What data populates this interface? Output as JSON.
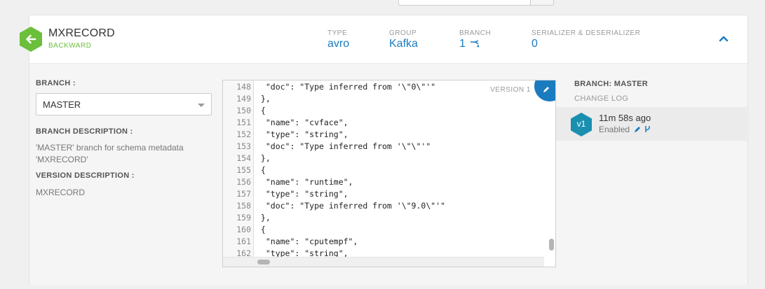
{
  "schema": {
    "name": "MXRECORD",
    "compatibility": "BACKWARD"
  },
  "meta": {
    "type_label": "TYPE",
    "type_value": "avro",
    "group_label": "GROUP",
    "group_value": "Kafka",
    "branch_label": "BRANCH",
    "branch_value": "1",
    "serde_label": "SERIALIZER & DESERIALIZER",
    "serde_value": "0"
  },
  "left": {
    "branch_label": "BRANCH :",
    "branch_selected": "MASTER",
    "branch_desc_label": "BRANCH DESCRIPTION :",
    "branch_desc": "'MASTER' branch for schema metadata 'MXRECORD'",
    "version_desc_label": "VERSION DESCRIPTION :",
    "version_desc": "MXRECORD"
  },
  "editor": {
    "version_label": "VERSION 1",
    "lines": [
      {
        "n": "148",
        "t": "  \"doc\": \"Type inferred from '\\\"0\\\"'\""
      },
      {
        "n": "149",
        "t": " },"
      },
      {
        "n": "150",
        "t": " {"
      },
      {
        "n": "151",
        "t": "  \"name\": \"cvface\","
      },
      {
        "n": "152",
        "t": "  \"type\": \"string\","
      },
      {
        "n": "153",
        "t": "  \"doc\": \"Type inferred from '\\\"\\\"'\""
      },
      {
        "n": "154",
        "t": " },"
      },
      {
        "n": "155",
        "t": " {"
      },
      {
        "n": "156",
        "t": "  \"name\": \"runtime\","
      },
      {
        "n": "157",
        "t": "  \"type\": \"string\","
      },
      {
        "n": "158",
        "t": "  \"doc\": \"Type inferred from '\\\"9.0\\\"'\""
      },
      {
        "n": "159",
        "t": " },"
      },
      {
        "n": "160",
        "t": " {"
      },
      {
        "n": "161",
        "t": "  \"name\": \"cputempf\","
      },
      {
        "n": "162",
        "t": "  \"type\": \"string\","
      },
      {
        "n": "163",
        "t": ""
      }
    ]
  },
  "right": {
    "branch_title": "BRANCH: MASTER",
    "changelog_label": "CHANGE LOG",
    "version_badge": "v1",
    "version_time": "11m 58s ago",
    "version_state": "Enabled"
  },
  "colors": {
    "accent": "#1a7bbf",
    "compat_green": "#6bbf3b",
    "badge_teal": "#1a8fb0"
  }
}
